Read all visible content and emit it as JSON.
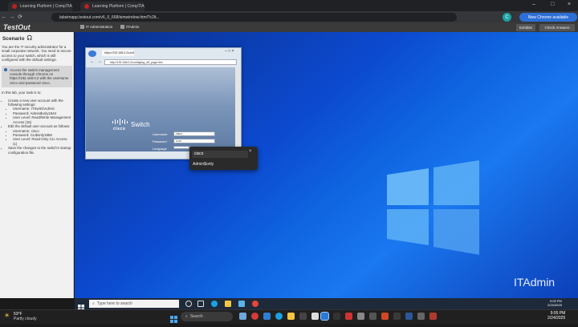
{
  "browser": {
    "tabs": [
      {
        "label": "Learning Platform | CompTIA"
      },
      {
        "label": "Learning Platform | CompTIA"
      }
    ],
    "url": "labsimapp.testout.com/v6_0_668/simwindow.html?c2lt...",
    "new_chrome_label": "New Chrome available",
    "profile_initial": "C"
  },
  "testout": {
    "logo": "TestOut",
    "it_admin": "IT Administration",
    "itadmin": "ITAdmin",
    "exhibits": "Exhibits",
    "check_answers": "Check Answers"
  },
  "scenario": {
    "title": "Scenario",
    "intro": "You are the IT security administrator for a small corporate network. You need to secure access to your switch, which is still configured with the default settings.",
    "callout": "Access the switch management console through Chrome on https://192.168.0.2 with the username cisco and password cisco.",
    "task_intro": "In this lab, your task is to:",
    "tasks": {
      "t1": "Create a new user account with the following settings:",
      "t1a": "Username: ITSwitchAdmin",
      "t1b": "Password: Admin$only1844",
      "t1c": "User Level: Read/Write Management Access (15)",
      "t2": "Edit the default user account as follows:",
      "t2a": "Username: cisco",
      "t2b": "Password: CLI$only1958",
      "t2c": "User Level: Read-Only CLI Access (1)",
      "t3": "Save the changes to the switch's startup configuration file."
    }
  },
  "ie": {
    "tab_label": "https://192.168.0.2/config/lo...",
    "address": "http://192.168.0.2/config/log_off_page.htm",
    "cisco": "cisco",
    "switch": "Switch",
    "username_label": "Username",
    "password_label": "Password",
    "language_label": "Language",
    "username_value": "cisco",
    "password_value": "••••••",
    "language_value": "English"
  },
  "autofill": {
    "username": "cisco",
    "password": "Admin$only",
    "close": "×"
  },
  "desktop": {
    "watermark": "ITAdmin"
  },
  "taskbar": {
    "search_placeholder": "Type here to search",
    "time": "9:05 PM",
    "date": "2/24/2025"
  },
  "windows": {
    "temp": "53°F",
    "weather": "Partly cloudy",
    "search": "Search",
    "time": "9:05 PM",
    "date": "2/24/2025"
  }
}
